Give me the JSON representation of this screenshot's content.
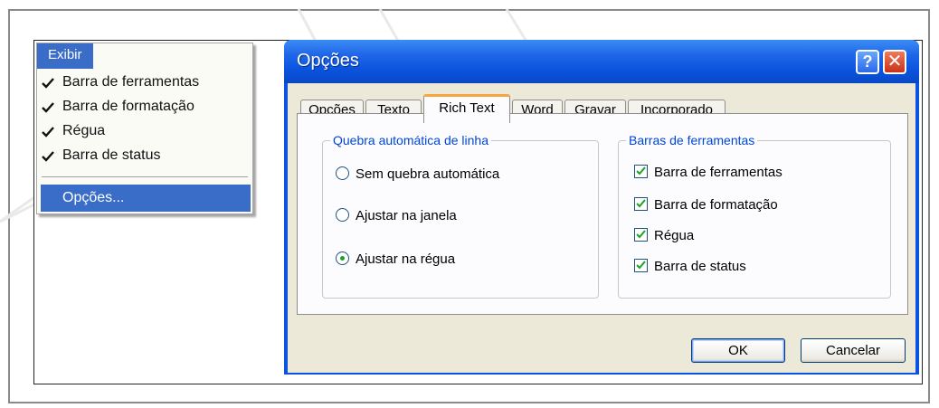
{
  "menu": {
    "title": "Exibir",
    "items": [
      {
        "label": "Barra de ferramentas",
        "checked": true
      },
      {
        "label": "Barra de formatação",
        "checked": true
      },
      {
        "label": "Régua",
        "checked": true
      },
      {
        "label": "Barra de status",
        "checked": true
      }
    ],
    "options_label": "Opções..."
  },
  "dialog": {
    "title": "Opções",
    "help_label": "?",
    "close_label": "✕",
    "tabs": [
      {
        "label": "Opções"
      },
      {
        "label": "Texto"
      },
      {
        "label": "Rich Text",
        "active": true
      },
      {
        "label": "Word"
      },
      {
        "label": "Gravar"
      },
      {
        "label": "Incorporado"
      }
    ],
    "wrap_group": {
      "title": "Quebra automática de linha",
      "options": [
        {
          "label": "Sem quebra automática",
          "selected": false
        },
        {
          "label": "Ajustar na janela",
          "selected": false
        },
        {
          "label": "Ajustar na régua",
          "selected": true
        }
      ]
    },
    "toolbars_group": {
      "title": "Barras de ferramentas",
      "options": [
        {
          "label": "Barra de ferramentas",
          "checked": true
        },
        {
          "label": "Barra de formatação",
          "checked": true
        },
        {
          "label": "Régua",
          "checked": true
        },
        {
          "label": "Barra de status",
          "checked": true
        }
      ]
    },
    "ok_label": "OK",
    "cancel_label": "Cancelar"
  },
  "colors": {
    "titlebar": "#0a53de",
    "menu_highlight": "#3a6dc8",
    "dialog_face": "#ece9d8",
    "group_title": "#0046d5",
    "tab_active_accent": "#f7a53e",
    "checkmark": "#21a121"
  }
}
